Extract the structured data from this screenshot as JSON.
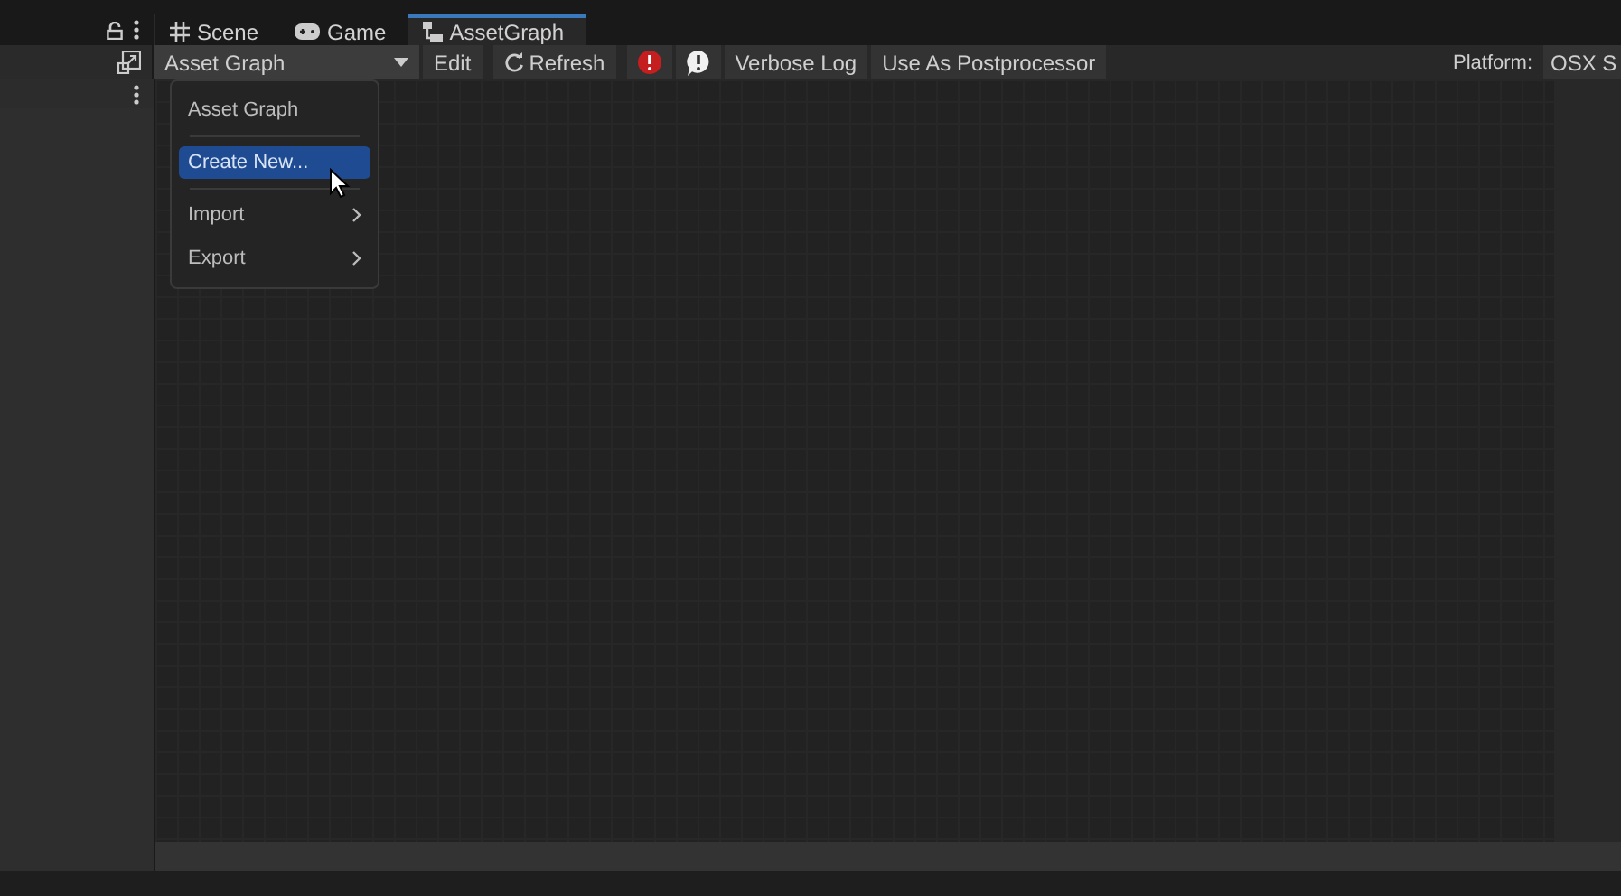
{
  "tabs": [
    {
      "label": "Scene",
      "kind": "grid",
      "selected": false
    },
    {
      "label": "Game",
      "kind": "gamepad",
      "selected": false
    },
    {
      "label": "AssetGraph",
      "kind": "graph",
      "selected": true
    }
  ],
  "toolbar": {
    "graph_select": "Asset Graph",
    "edit": "Edit",
    "refresh": "Refresh",
    "verbose": "Verbose Log",
    "postprocessor": "Use As Postprocessor",
    "platform_label": "Platform:",
    "platform_value": "OSX S"
  },
  "menu": [
    {
      "label": "Asset Graph",
      "selected": false,
      "submenu": false
    },
    {
      "label": "Create New...",
      "selected": true,
      "submenu": false
    },
    {
      "label": "Import",
      "selected": false,
      "submenu": true
    },
    {
      "label": "Export",
      "selected": false,
      "submenu": true
    }
  ]
}
